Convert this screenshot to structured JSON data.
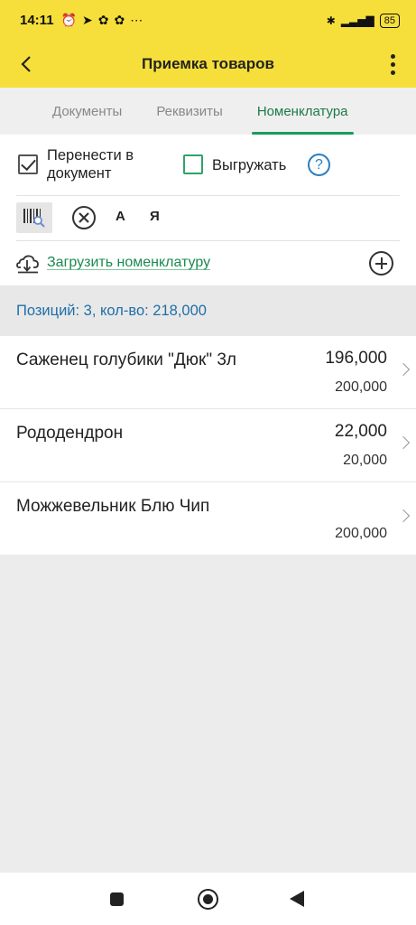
{
  "status_bar": {
    "time": "14:11",
    "battery": "85"
  },
  "header": {
    "title": "Приемка товаров"
  },
  "tabs": [
    {
      "label": "Документы",
      "active": false
    },
    {
      "label": "Реквизиты",
      "active": false
    },
    {
      "label": "Номенклатура",
      "active": true
    }
  ],
  "options": {
    "transfer_label_line1": "Перенести в",
    "transfer_label_line2": "документ",
    "transfer_checked": true,
    "export_label": "Выгружать",
    "export_checked": false,
    "help_label": "?"
  },
  "toolbar2": {
    "sort_a": "А",
    "sort_ya": "Я"
  },
  "load": {
    "link_label": "Загрузить номенклатуру"
  },
  "summary": "Позиций: 3, кол-во: 218,000",
  "items": [
    {
      "name": "Саженец голубики \"Дюк\" 3л",
      "qty": "196,000",
      "qty2": "200,000"
    },
    {
      "name": "Рододендрон",
      "qty": "22,000",
      "qty2": "20,000"
    },
    {
      "name": "Можжевельник Блю Чип",
      "qty": "",
      "qty2": "200,000"
    }
  ],
  "colors": {
    "accent_yellow": "#f6df3a",
    "accent_green": "#1b8a4f",
    "summary_blue": "#1f6fa8"
  }
}
